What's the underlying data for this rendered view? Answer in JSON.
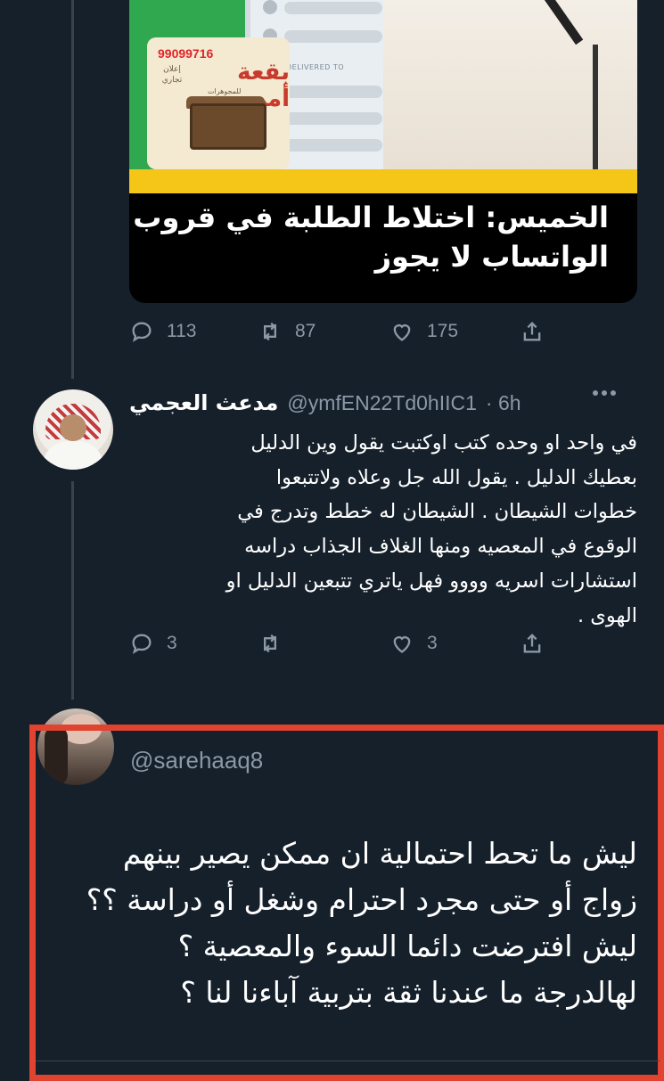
{
  "embed_card": {
    "ad_phone": "99099716",
    "ad_note": "إعلان تجاري",
    "ad_logo": "بقعة أمي",
    "ad_subtitle": "للمجوهرات",
    "delivered_label": "DELIVERED TO",
    "headline_line1": "الخميس: اختلاط الطلبة في قروب",
    "headline_line2": "الواتساب لا يجوز"
  },
  "first_tweet_actions": {
    "replies": "113",
    "retweets": "87",
    "likes": "175"
  },
  "reply_tweet": {
    "author_name": "مدعث العجمي",
    "handle": "@ymfEN22Td0hIIC1",
    "time": "· 6h",
    "lines": [
      "في واحد او وحده كتب  اوكتبت يقول وين الدليل",
      "بعطيك الدليل . يقول الله جل وعلاه ولاتتبعوا",
      "خطوات الشيطان . الشيطان له خطط وتدرج في",
      "الوقوع في المعصيه ومنها الغلاف الجذاب دراسه",
      "استشارات اسريه وووو فهل ياتري تتبعين الدليل او",
      "الهوى ."
    ],
    "replies": "3",
    "likes": "3"
  },
  "highlighted_tweet": {
    "handle": "@sarehaaq8",
    "lines": [
      "ليش ما تحط احتمالية ان ممكن يصير بينهم",
      "زواج أو حتى مجرد احترام وشغل أو دراسة ؟؟",
      "ليش افترضت دائما السوء والمعصية ؟",
      "لهالدرجة ما عندنا ثقة بتربية آباءنا لنا ؟"
    ]
  },
  "colors": {
    "background": "#15202b",
    "secondary_text": "#8b98a5",
    "highlight_border": "#e0432f",
    "card_band": "#f5c518"
  }
}
